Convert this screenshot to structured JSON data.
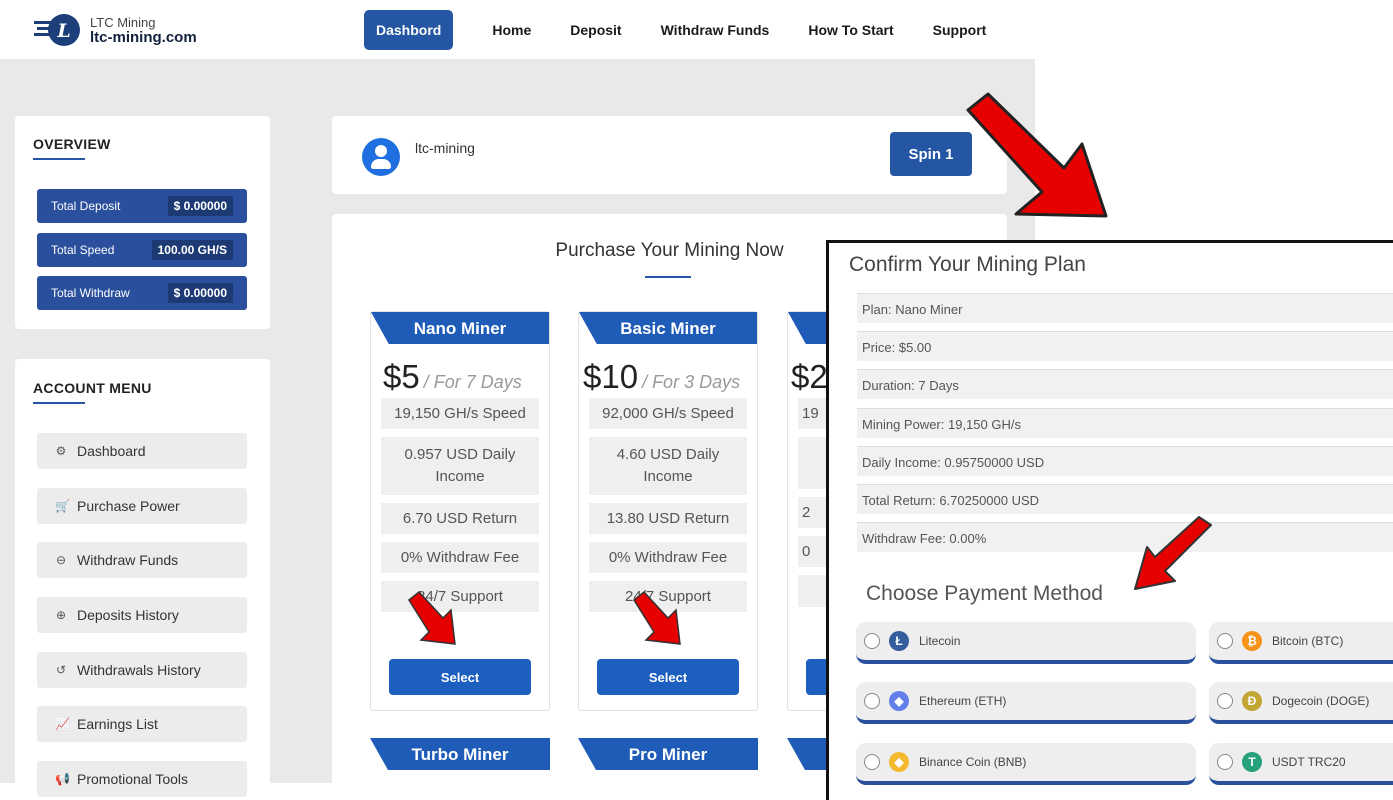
{
  "brand": {
    "small": "LTC Mining",
    "big": "ltc-mining.com",
    "logo_letter": "L"
  },
  "nav": [
    {
      "label": "Dashbord",
      "active": true
    },
    {
      "label": "Home"
    },
    {
      "label": "Deposit"
    },
    {
      "label": "Withdraw Funds"
    },
    {
      "label": "How To Start"
    },
    {
      "label": "Support"
    }
  ],
  "overview": {
    "title": "OVERVIEW",
    "stats": [
      {
        "label": "Total Deposit",
        "value": "$ 0.00000"
      },
      {
        "label": "Total Speed",
        "value": "100.00 GH/S"
      },
      {
        "label": "Total Withdraw",
        "value": "$ 0.00000"
      }
    ]
  },
  "account_menu": {
    "title": "ACCOUNT MENU",
    "items": [
      {
        "label": "Dashboard",
        "icon": "dashboard-icon",
        "glyph": "⚙"
      },
      {
        "label": "Purchase Power",
        "icon": "cart-icon",
        "glyph": "🛒"
      },
      {
        "label": "Withdraw Funds",
        "icon": "withdraw-icon",
        "glyph": "⊖"
      },
      {
        "label": "Deposits History",
        "icon": "deposit-icon",
        "glyph": "⊕"
      },
      {
        "label": "Withdrawals History",
        "icon": "history-icon",
        "glyph": "↺"
      },
      {
        "label": "Earnings List",
        "icon": "chart-icon",
        "glyph": "📈"
      },
      {
        "label": "Promotional Tools",
        "icon": "megaphone-icon",
        "glyph": "📢"
      }
    ]
  },
  "profile": {
    "username": "ltc-mining",
    "spin_label": "Spin 1"
  },
  "plans": {
    "title": "Purchase Your Mining Now",
    "cards": [
      {
        "name": "Nano Miner",
        "price": "$5",
        "period": "/ For 7 Days",
        "features": [
          "19,150 GH/s Speed",
          "0.957 USD Daily Income",
          "6.70 USD Return",
          "0% Withdraw Fee",
          "24/7 Support"
        ],
        "select": "Select"
      },
      {
        "name": "Basic Miner",
        "price": "$10",
        "period": "/ For 3 Days",
        "features": [
          "92,000 GH/s Speed",
          "4.60 USD Daily Income",
          "13.80 USD Return",
          "0% Withdraw Fee",
          "24/7 Support"
        ],
        "select": "Select"
      },
      {
        "name": "",
        "price": "$2",
        "period": "",
        "features": [
          "19",
          "",
          "2",
          "0",
          ""
        ],
        "select": ""
      }
    ],
    "next_row": [
      "Turbo Miner",
      "Pro Miner"
    ]
  },
  "confirm": {
    "title": "Confirm Your Mining Plan",
    "rows": [
      "Plan: Nano Miner",
      "Price: $5.00",
      "Duration: 7 Days",
      "Mining Power: 19,150 GH/s",
      "Daily Income: 0.95750000 USD",
      "Total Return: 6.70250000 USD",
      "Withdraw Fee: 0.00%"
    ],
    "payment_title": "Choose Payment Method",
    "methods": [
      {
        "label": "Litecoin",
        "icon": "litecoin-icon",
        "color": "#345d9d",
        "glyph": "Ł"
      },
      {
        "label": "Bitcoin (BTC)",
        "icon": "bitcoin-icon",
        "color": "#f7931a",
        "glyph": "₿"
      },
      {
        "label": "Ethereum (ETH)",
        "icon": "ethereum-icon",
        "color": "#627eea",
        "glyph": "◆"
      },
      {
        "label": "Dogecoin (DOGE)",
        "icon": "dogecoin-icon",
        "color": "#c2a633",
        "glyph": "Ð"
      },
      {
        "label": "Binance Coin (BNB)",
        "icon": "bnb-icon",
        "color": "#f3ba2f",
        "glyph": "◆"
      },
      {
        "label": "USDT TRC20",
        "icon": "tether-icon",
        "color": "#26a17b",
        "glyph": "T"
      }
    ]
  },
  "colors": {
    "primary": "#2456a3",
    "arrow": "#e60000"
  }
}
